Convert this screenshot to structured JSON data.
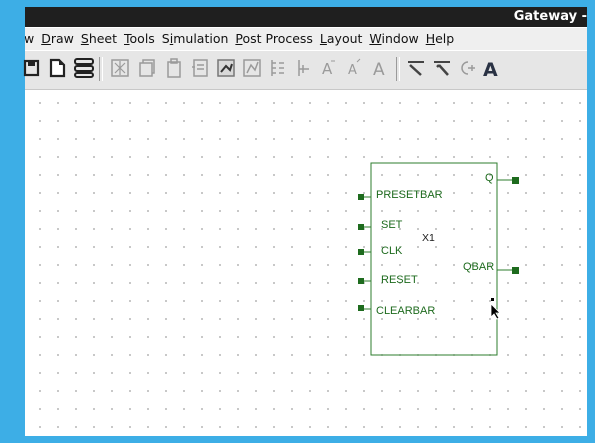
{
  "window": {
    "title": "Gateway -"
  },
  "menubar": {
    "items": [
      {
        "label": "w",
        "accel": ""
      },
      {
        "label": "Draw",
        "accel": "D"
      },
      {
        "label": "Sheet",
        "accel": "S"
      },
      {
        "label": "Tools",
        "accel": "T"
      },
      {
        "label": "Simulation",
        "accel": "i"
      },
      {
        "label": "Post Process",
        "accel": "P"
      },
      {
        "label": "Layout",
        "accel": "L"
      },
      {
        "label": "Window",
        "accel": "W"
      },
      {
        "label": "Help",
        "accel": "H"
      }
    ]
  },
  "toolbar": {
    "icons": [
      "save-icon",
      "new-sheet-icon",
      "stack-icon",
      "place-component-icon",
      "copy-icon",
      "paste-icon",
      "component-editor-icon",
      "wire-tool-icon",
      "netlist-icon",
      "bus-icon",
      "pin-icon",
      "text-small-icon",
      "text-medium-icon",
      "text-large-icon",
      "probe-icon",
      "probe-alt-icon",
      "marker-icon",
      "font-icon"
    ]
  },
  "schematic": {
    "component": {
      "instance_name": "X1",
      "inputs": [
        "PRESETBAR",
        "SET",
        "CLK",
        "RESET",
        "CLEARBAR"
      ],
      "outputs": [
        "Q",
        "QBAR"
      ]
    },
    "colors": {
      "wire": "#2d7d2d",
      "pin_terminal": "#1e6b1e",
      "grid_dot": "#b9b9b9"
    }
  }
}
